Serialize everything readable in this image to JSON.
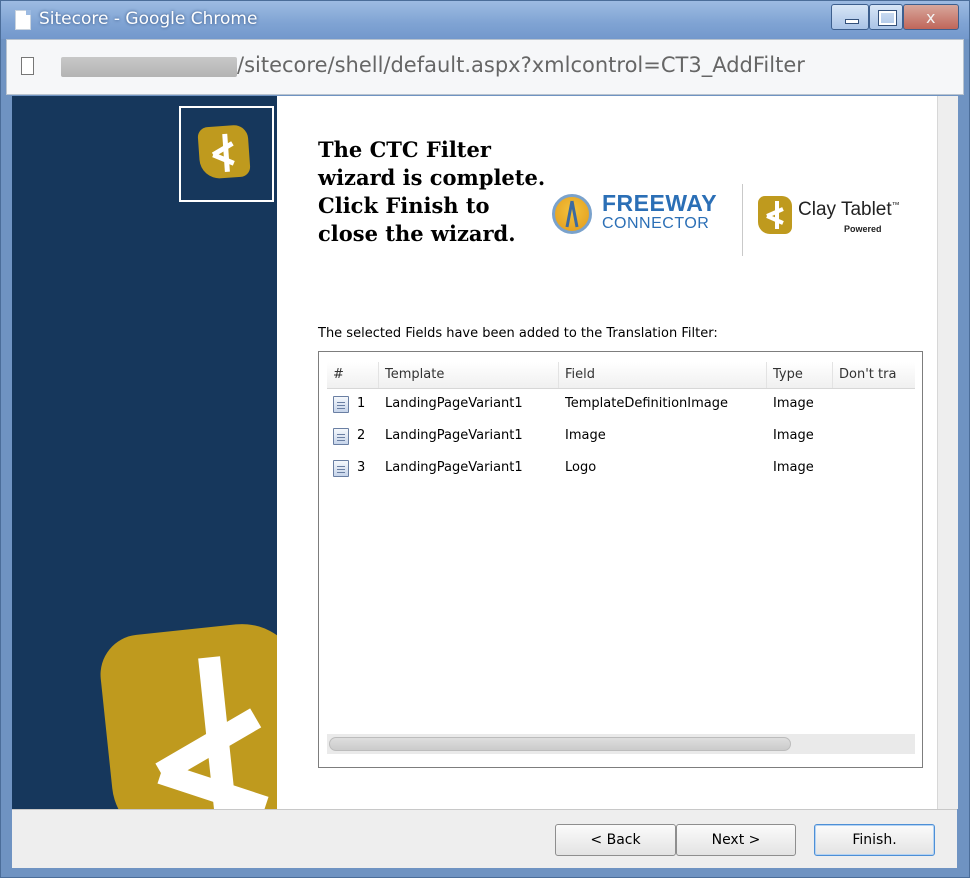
{
  "window": {
    "title": "Sitecore - Google Chrome",
    "buttons": {
      "minimize": "",
      "maximize": "",
      "close": "x"
    }
  },
  "address_bar": {
    "url_visible": "/sitecore/shell/default.aspx?xmlcontrol=CT3_AddFilter"
  },
  "wizard": {
    "heading": "The CTC Filter wizard is complete. Click Finish to close the wizard.",
    "intro": "The selected Fields have been added to the Translation Filter:",
    "brand": {
      "freeway_line1": "FREEWAY",
      "freeway_line2": "CONNECTOR",
      "claytablet": "Clay Tablet",
      "tm": "™",
      "powered": "Powered"
    },
    "table": {
      "columns": [
        "#",
        "Template",
        "Field",
        "Type",
        "Don't tra"
      ],
      "rows": [
        {
          "num": "1",
          "template": "LandingPageVariant1",
          "field": "TemplateDefinitionImage",
          "type": "Image"
        },
        {
          "num": "2",
          "template": "LandingPageVariant1",
          "field": "Image",
          "type": "Image"
        },
        {
          "num": "3",
          "template": "LandingPageVariant1",
          "field": "Logo",
          "type": "Image"
        }
      ]
    },
    "buttons": {
      "back": "< Back",
      "next": "Next >",
      "finish": "Finish."
    }
  },
  "colors": {
    "left_panel": "#16375c",
    "logo_gold": "#bf9a1e",
    "titlebar": "#7fa3d3"
  }
}
